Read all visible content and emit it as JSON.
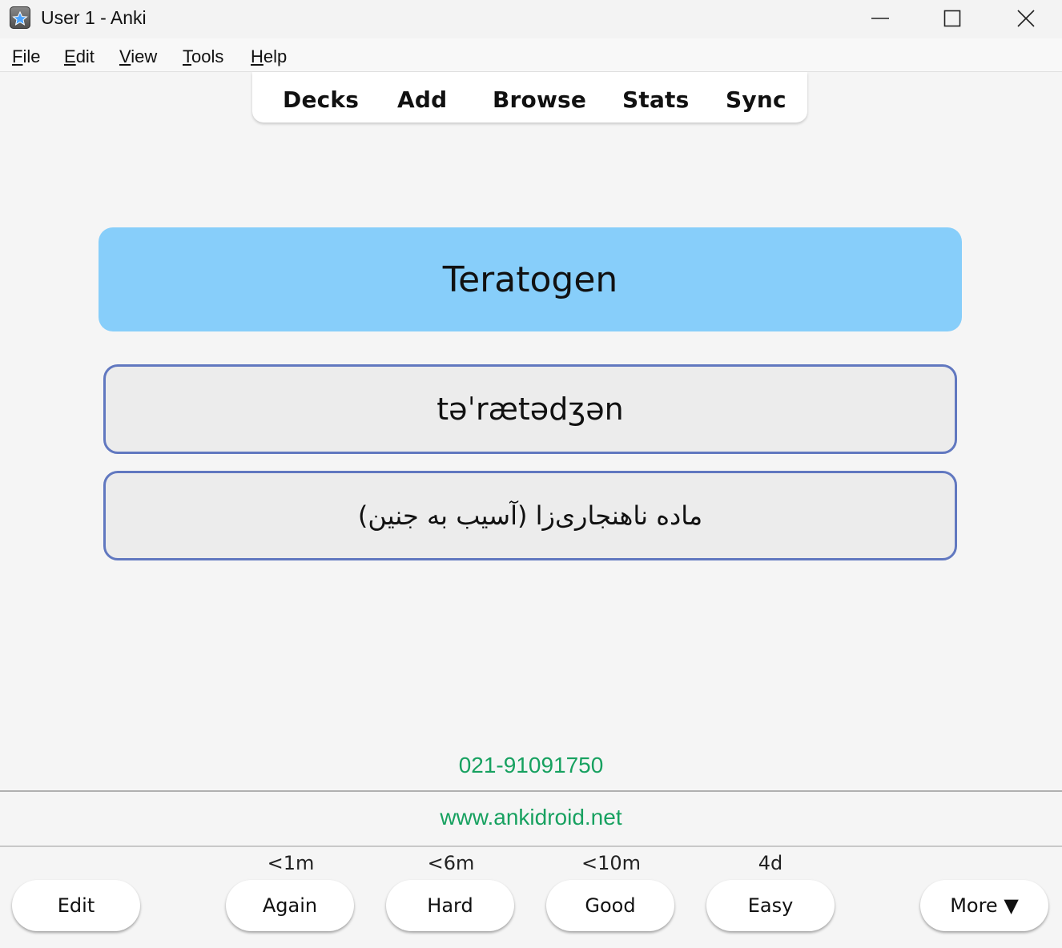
{
  "window": {
    "title": "User 1 - Anki"
  },
  "menu": {
    "items": [
      {
        "first": "F",
        "rest": "ile"
      },
      {
        "first": "E",
        "rest": "dit"
      },
      {
        "first": "V",
        "rest": "iew"
      },
      {
        "first": "T",
        "rest": "ools"
      },
      {
        "first": "H",
        "rest": "elp"
      }
    ]
  },
  "toolbar": {
    "decks": "Decks",
    "add": "Add",
    "browse": "Browse",
    "stats": "Stats",
    "sync": "Sync"
  },
  "card": {
    "front": "Teratogen",
    "pronunciation": "təˈrætədʒən",
    "meaning": "ماده ناهنجاری‌زا (آسیب به جنین)",
    "phone": "021-91091750",
    "website": "www.ankidroid.net"
  },
  "bottom": {
    "edit": "Edit",
    "again": {
      "label": "Again",
      "interval": "<1m"
    },
    "hard": {
      "label": "Hard",
      "interval": "<6m"
    },
    "good": {
      "label": "Good",
      "interval": "<10m"
    },
    "easy": {
      "label": "Easy",
      "interval": "4d"
    },
    "more": "More ▼"
  },
  "colors": {
    "front_bg": "#87cefa",
    "back_border": "#6178c0",
    "link_green": "#17a160"
  }
}
